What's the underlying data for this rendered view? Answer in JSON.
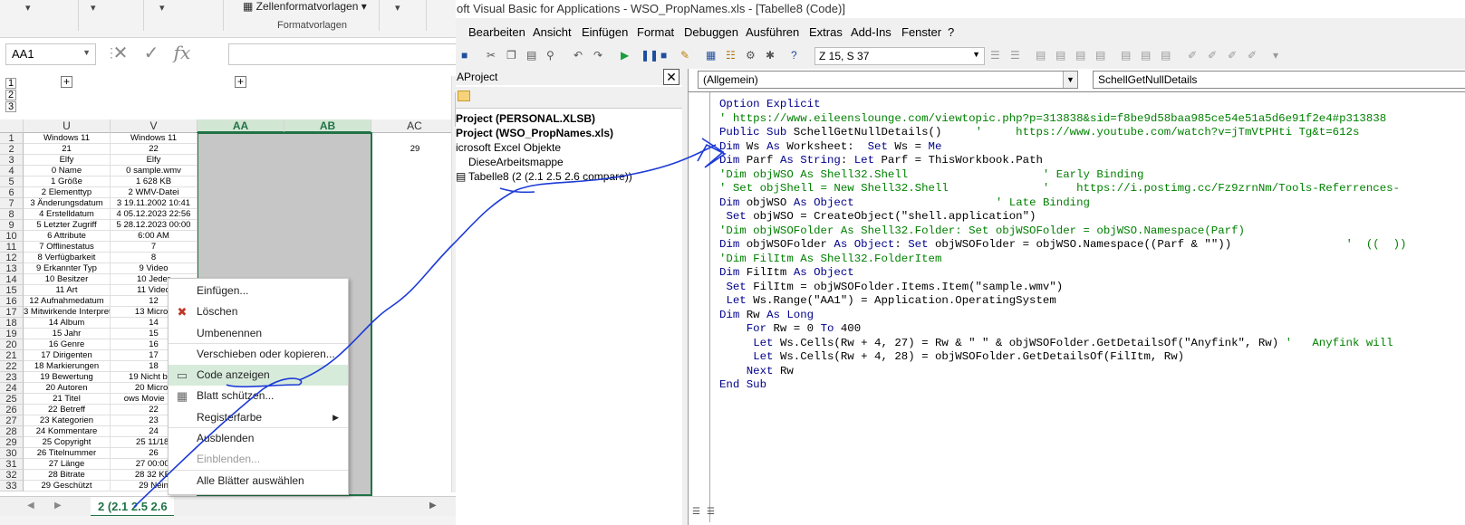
{
  "excel": {
    "ribbon": {
      "zellenformat": "Zellenformatvorlagen",
      "formatvorlagen": "Formatvorlagen"
    },
    "namebox": "AA1",
    "formula_icons": [
      "✕",
      "✓",
      "fx"
    ],
    "outline_levels": [
      "1",
      "2",
      "3"
    ],
    "columns": [
      "U",
      "V",
      "AA",
      "AB",
      "AC"
    ],
    "row_numbers": [
      "1",
      "2",
      "3",
      "4",
      "5",
      "6",
      "7",
      "8",
      "9",
      "10",
      "11",
      "12",
      "13",
      "14",
      "15",
      "16",
      "17",
      "18",
      "19",
      "20",
      "21",
      "22",
      "23",
      "24",
      "25",
      "26",
      "27",
      "28",
      "29",
      "30",
      "31",
      "32",
      "33"
    ],
    "col_u": [
      "Windows 11",
      "21",
      "Elfy",
      "0 Name",
      "1 Größe",
      "2 Elementtyp",
      "3 Änderungsdatum",
      "4 Erstelldatum",
      "5 Letzter Zugriff",
      "6 Attribute",
      "7 Offlinestatus",
      "8 Verfügbarkeit",
      "9 Erkannter Typ",
      "10 Besitzer",
      "11 Art",
      "12 Aufnahmedatum",
      "3 Mitwirkende Interprete",
      "14 Album",
      "15 Jahr",
      "16 Genre",
      "17 Dirigenten",
      "18 Markierungen",
      "19 Bewertung",
      "20 Autoren",
      "21 Titel",
      "22 Betreff",
      "23 Kategorien",
      "24 Kommentare",
      "25 Copyright",
      "26 Titelnummer",
      "27 Länge",
      "28 Bitrate",
      "29 Geschützt"
    ],
    "col_v": [
      "Windows 11",
      "22",
      "Elfy",
      "0 sample.wmv",
      "1 628 KB",
      "2 WMV-Datei",
      "3 19.11.2002 10:41",
      "4 05.12.2023 22:56",
      "5 28.12.2023 00:00",
      "6:00 AM",
      "7",
      "8",
      "9 Video",
      "10 Jeder",
      "11 Video",
      "12",
      "13 Micros",
      "14",
      "15",
      "16",
      "17",
      "18",
      "19 Nicht bew",
      "20 Micros",
      "ows Movie Mak",
      "22",
      "23",
      "24",
      "25 11/18/",
      "26",
      "27 00:00:",
      "28 32 KBi",
      "29 Nein"
    ],
    "ac_row2": "29",
    "sheet_tab": "2 (2.1 2.5 2.6",
    "context_menu": [
      {
        "label": "Einfügen...",
        "icon": "",
        "disabled": false
      },
      {
        "label": "Löschen",
        "icon": "delete-sheet-icon",
        "disabled": false
      },
      {
        "label": "Umbenennen",
        "icon": "",
        "disabled": false
      },
      {
        "label": "Verschieben oder kopieren...",
        "icon": "",
        "disabled": false
      },
      {
        "label": "Code anzeigen",
        "icon": "view-code-icon",
        "disabled": false,
        "highlighted": true
      },
      {
        "label": "Blatt schützen...",
        "icon": "protect-sheet-icon",
        "disabled": false
      },
      {
        "label": "Registerfarbe",
        "icon": "",
        "disabled": false,
        "submenu": true
      },
      {
        "label": "Ausblenden",
        "icon": "",
        "disabled": false
      },
      {
        "label": "Einblenden...",
        "icon": "",
        "disabled": true
      },
      {
        "label": "Alle Blätter auswählen",
        "icon": "",
        "disabled": false
      }
    ]
  },
  "vba": {
    "title": "oft Visual Basic for Applications - WSO_PropNames.xls - [Tabelle8 (Code)]",
    "menu": [
      "Bearbeiten",
      "Ansicht",
      "Einfügen",
      "Format",
      "Debuggen",
      "Ausführen",
      "Extras",
      "Add-Ins",
      "Fenster",
      "?"
    ],
    "position": "Z 15, S 37",
    "project_title": "AProject",
    "project_close": "✕",
    "project_tree": [
      "Project (PERSONAL.XLSB)",
      "Project (WSO_PropNames.xls)",
      "icrosoft Excel Objekte",
      "DieseArbeitsmappe",
      "Tabelle8 (2 (2.1 2.5 2.6 compare))"
    ],
    "object_combo": "(Allgemein)",
    "proc_combo": "SchellGetNullDetails",
    "code": [
      [
        [
          "kw",
          "Option Explicit"
        ]
      ],
      [
        [
          "cm",
          "' https://www.eileenslounge.com/viewtopic.php?p=313838&sid=f8be9d58baa985ce54e51a5d6e91f2e4#p313838"
        ]
      ],
      [
        [
          "kw",
          "Public Sub "
        ],
        [
          "pl",
          "SchellGetNullDetails()     "
        ],
        [
          "cm",
          "'     https://www.youtube.com/watch?v=jTmVtPHti Tg&t=612s"
        ]
      ],
      [
        [
          "kw",
          "Dim "
        ],
        [
          "pl",
          "Ws "
        ],
        [
          "kw",
          "As "
        ],
        [
          "pl",
          "Worksheet:  "
        ],
        [
          "kw",
          "Set "
        ],
        [
          "pl",
          "Ws = "
        ],
        [
          "kw",
          "Me"
        ]
      ],
      [
        [
          "kw",
          "Dim "
        ],
        [
          "pl",
          "Parf "
        ],
        [
          "kw",
          "As String"
        ],
        [
          "pl",
          ": "
        ],
        [
          "kw",
          "Let "
        ],
        [
          "pl",
          "Parf = ThisWorkbook.Path"
        ]
      ],
      [
        [
          "cm",
          "'Dim objWSO As Shell32.Shell                    ' Early Binding"
        ]
      ],
      [
        [
          "cm",
          "' Set objShell = New Shell32.Shell              '    https://i.postimg.cc/Fz9zrnNm/Tools-Referrences-"
        ]
      ],
      [
        [
          "kw",
          "Dim "
        ],
        [
          "pl",
          "objWSO "
        ],
        [
          "kw",
          "As Object                     "
        ],
        [
          "cm",
          "' Late Binding"
        ]
      ],
      [
        [
          "pl",
          " "
        ],
        [
          "kw",
          "Set "
        ],
        [
          "pl",
          "objWSO = CreateObject(\"shell.application\")"
        ]
      ],
      [
        [
          "cm",
          "'Dim objWSOFolder As Shell32.Folder: Set objWSOFolder = objWSO.Namespace(Parf)"
        ]
      ],
      [
        [
          "kw",
          "Dim "
        ],
        [
          "pl",
          "objWSOFolder "
        ],
        [
          "kw",
          "As Object"
        ],
        [
          "pl",
          ": "
        ],
        [
          "kw",
          "Set "
        ],
        [
          "pl",
          "objWSOFolder = objWSO.Namespace((Parf & \"\"))                 "
        ],
        [
          "cm",
          "'  ((  ))"
        ]
      ],
      [
        [
          "cm",
          "'Dim FilItm As Shell32.FolderItem"
        ]
      ],
      [
        [
          "kw",
          "Dim "
        ],
        [
          "pl",
          "FilItm "
        ],
        [
          "kw",
          "As Object"
        ]
      ],
      [
        [
          "pl",
          " "
        ],
        [
          "kw",
          "Set "
        ],
        [
          "pl",
          "FilItm = objWSOFolder.Items.Item(\"sample.wmv\")"
        ]
      ],
      [
        [
          "pl",
          " "
        ],
        [
          "kw",
          "Let "
        ],
        [
          "pl",
          "Ws.Range(\"AA1\") = Application.OperatingSystem"
        ]
      ],
      [
        [
          "kw",
          "Dim "
        ],
        [
          "pl",
          "Rw "
        ],
        [
          "kw",
          "As Long"
        ]
      ],
      [
        [
          "pl",
          "    "
        ],
        [
          "kw",
          "For "
        ],
        [
          "pl",
          "Rw = 0 "
        ],
        [
          "kw",
          "To "
        ],
        [
          "pl",
          "400"
        ]
      ],
      [
        [
          "pl",
          "     "
        ],
        [
          "kw",
          "Let "
        ],
        [
          "pl",
          "Ws.Cells(Rw + 4, 27) = Rw & \" \" & objWSOFolder.GetDetailsOf(\"Anyfink\", Rw) "
        ],
        [
          "cm",
          "'   Anyfink will"
        ]
      ],
      [
        [
          "pl",
          "     "
        ],
        [
          "kw",
          "Let "
        ],
        [
          "pl",
          "Ws.Cells(Rw + 4, 28) = objWSOFolder.GetDetailsOf(FilItm, Rw)"
        ]
      ],
      [
        [
          "pl",
          "    "
        ],
        [
          "kw",
          "Next "
        ],
        [
          "pl",
          "Rw"
        ]
      ],
      [
        [
          "kw",
          "End Sub"
        ]
      ]
    ]
  }
}
